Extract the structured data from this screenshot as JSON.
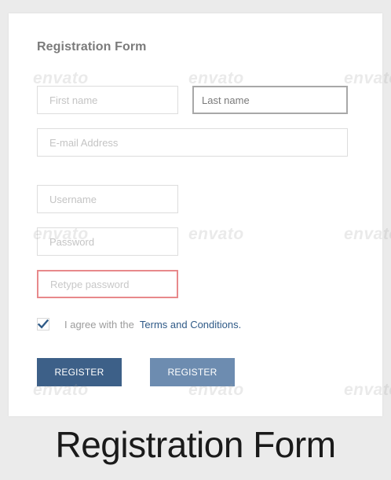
{
  "form": {
    "title": "Registration Form",
    "fields": {
      "first_name_placeholder": "First name",
      "last_name_placeholder": "Last name",
      "email_placeholder": "E-mail Address",
      "username_placeholder": "Username",
      "password_placeholder": "Password",
      "retype_password_placeholder": "Retype password"
    },
    "agree": {
      "checked": true,
      "text": "I agree with the",
      "link_text": "Terms and Conditions",
      "trailing": "."
    },
    "buttons": {
      "primary_label": "REGISTER",
      "secondary_label": "REGISTER"
    }
  },
  "caption": "Registration Form",
  "watermark_text": "envato",
  "colors": {
    "primary_button": "#3d6088",
    "secondary_button": "#6d8cb0",
    "link": "#2f5a87",
    "error_border": "#e8898b",
    "checkmark": "#2f5a87"
  },
  "icons": {
    "checkbox_mark": "checkmark-icon"
  }
}
